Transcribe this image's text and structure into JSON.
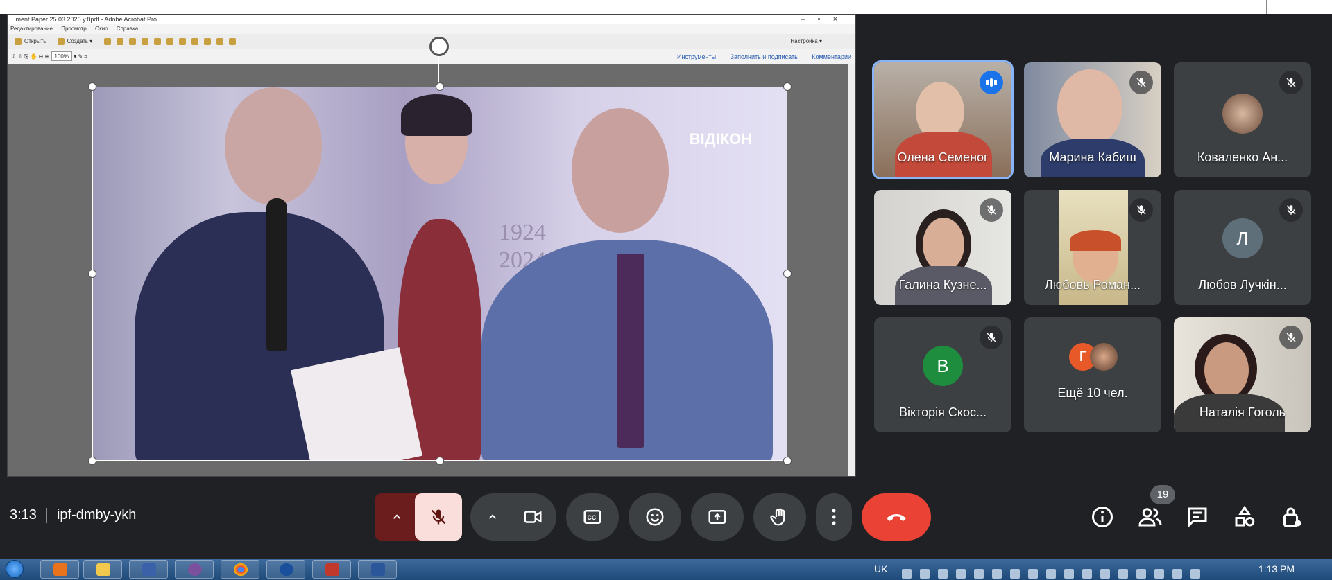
{
  "top_heading": "",
  "acrobat": {
    "title": "...ment Paper 25.03.2025 y.8pdf - Adobe Acrobat Pro",
    "menu": [
      "Редактирование",
      "Просмотр",
      "Окно",
      "Справка"
    ],
    "open_label": "Открыть",
    "create_label": "Создать",
    "settings_label": "Настройка",
    "zoom_value": "100%",
    "tools_label": "Инструменты",
    "fill_sign_label": "Заполнить и подписать",
    "comments_label": "Комментарии"
  },
  "photo": {
    "logo_text": "ВІДІКОН",
    "years": [
      "1924",
      "2024"
    ]
  },
  "participants": [
    {
      "name": "Олена Семеног",
      "type": "video",
      "speaking": true
    },
    {
      "name": "Марина Кабиш",
      "type": "video",
      "muted": true
    },
    {
      "name": "Коваленко Ан...",
      "type": "photo-avatar",
      "muted": true
    },
    {
      "name": "Галина Кузне...",
      "type": "video",
      "muted": true
    },
    {
      "name": "Любовь Роман...",
      "type": "video",
      "muted": true
    },
    {
      "name": "Любов Лучкін...",
      "type": "letter",
      "letter": "Л",
      "color": "#5f6f7a",
      "muted": true
    },
    {
      "name": "Вікторія Скос...",
      "type": "letter",
      "letter": "В",
      "color": "#1e8e3e",
      "muted": true
    },
    {
      "name": "Ещё 10 чел.",
      "type": "more",
      "letter": "Г",
      "color": "#e8592a"
    },
    {
      "name": "Наталія Гоголь",
      "type": "video",
      "muted": true
    }
  ],
  "meeting": {
    "time": "3:13",
    "code": "ipf-dmby-ykh",
    "people_count": "19"
  },
  "colors": {
    "bg": "#202124",
    "tile": "#3c4043",
    "end_call": "#ea4335",
    "active_outline": "#8ab4f8"
  },
  "taskbar": {
    "lang": "UK",
    "clock": "1:13 PM"
  }
}
